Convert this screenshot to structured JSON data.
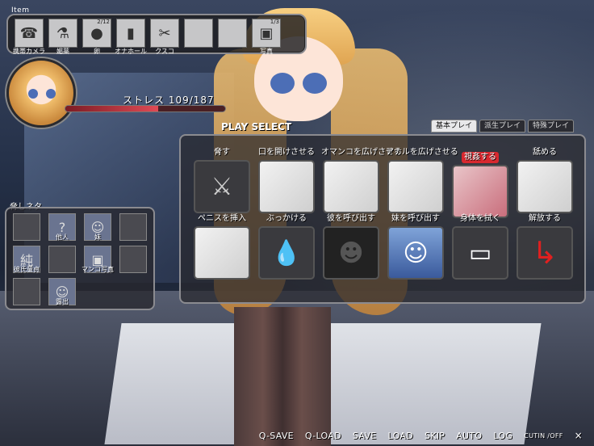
{
  "items": {
    "label": "Item",
    "slots": [
      {
        "label": "携帯カメラ",
        "icon": "phone-icon",
        "glyph": "☎",
        "count": ""
      },
      {
        "label": "媚薬",
        "icon": "bottle-icon",
        "glyph": "⚗",
        "count": ""
      },
      {
        "label": "卵",
        "icon": "egg-icon",
        "glyph": "●",
        "count": "2/12"
      },
      {
        "label": "オナホール",
        "icon": "tube-icon",
        "glyph": "▮",
        "count": ""
      },
      {
        "label": "クスコ",
        "icon": "speculum-icon",
        "glyph": "✂",
        "count": ""
      },
      {
        "label": "",
        "icon": "empty-slot",
        "glyph": "",
        "count": ""
      },
      {
        "label": "",
        "icon": "empty-slot",
        "glyph": "",
        "count": ""
      },
      {
        "label": "写真",
        "icon": "photo-icon",
        "glyph": "▣",
        "count": "1/3"
      }
    ]
  },
  "status": {
    "stress_text": "ストレス 109/187",
    "stress_value": 109,
    "stress_max": 187
  },
  "play": {
    "title": "PLAY SELECT",
    "tabs": [
      "基本プレイ",
      "派生プレイ",
      "特殊プレイ"
    ],
    "active_tab": 0,
    "actions": [
      {
        "label": "脅す",
        "icon": "knife-icon",
        "glyph": "⚔",
        "style": "dark",
        "highlight": false
      },
      {
        "label": "口を開けさせる",
        "icon": "sketch-thumb",
        "glyph": "",
        "style": "sketch",
        "highlight": false
      },
      {
        "label": "オマンコを広げさせる",
        "icon": "sketch-thumb",
        "glyph": "",
        "style": "sketch",
        "highlight": false
      },
      {
        "label": "アナルを広げさせる",
        "icon": "sketch-thumb",
        "glyph": "",
        "style": "sketch",
        "highlight": false
      },
      {
        "label": "視姦する",
        "icon": "color-thumb",
        "glyph": "",
        "style": "red",
        "highlight": true
      },
      {
        "label": "舐める",
        "icon": "sketch-thumb",
        "glyph": "",
        "style": "sketch",
        "highlight": false
      },
      {
        "label": "ペニスを挿入",
        "icon": "sketch-thumb",
        "glyph": "",
        "style": "sketch",
        "highlight": false
      },
      {
        "label": "ぶっかける",
        "icon": "drop-icon",
        "glyph": "💧",
        "style": "dark",
        "highlight": false
      },
      {
        "label": "彼を呼び出す",
        "icon": "silhouette-icon",
        "glyph": "☻",
        "style": "black",
        "highlight": false
      },
      {
        "label": "妹を呼び出す",
        "icon": "sister-portrait",
        "glyph": "☺",
        "style": "blue",
        "highlight": false
      },
      {
        "label": "身体を拭く",
        "icon": "towel-icon",
        "glyph": "▭",
        "style": "dark",
        "highlight": false
      },
      {
        "label": "解放する",
        "icon": "release-arrow-icon",
        "glyph": "↳",
        "style": "dark",
        "highlight": false
      }
    ]
  },
  "blackmail": {
    "label": "脅しネタ",
    "slots": [
      {
        "label": "",
        "filled": false,
        "glyph": ""
      },
      {
        "label": "他人",
        "filled": true,
        "glyph": "?"
      },
      {
        "label": "妹",
        "filled": true,
        "glyph": "☺"
      },
      {
        "label": "",
        "filled": false,
        "glyph": ""
      },
      {
        "label": "彼氏童貞",
        "filled": true,
        "glyph": "純"
      },
      {
        "label": "",
        "filled": false,
        "glyph": ""
      },
      {
        "label": "マンコ写真",
        "filled": true,
        "glyph": "▣"
      },
      {
        "label": "",
        "filled": false,
        "glyph": ""
      },
      {
        "label": "",
        "filled": false,
        "glyph": ""
      },
      {
        "label": "露出",
        "filled": true,
        "glyph": "☺"
      }
    ]
  },
  "menu": [
    "Q-SAVE",
    "Q-LOAD",
    "SAVE",
    "LOAD",
    "SKIP",
    "AUTO",
    "LOG",
    "CUTIN /OFF",
    "×"
  ]
}
